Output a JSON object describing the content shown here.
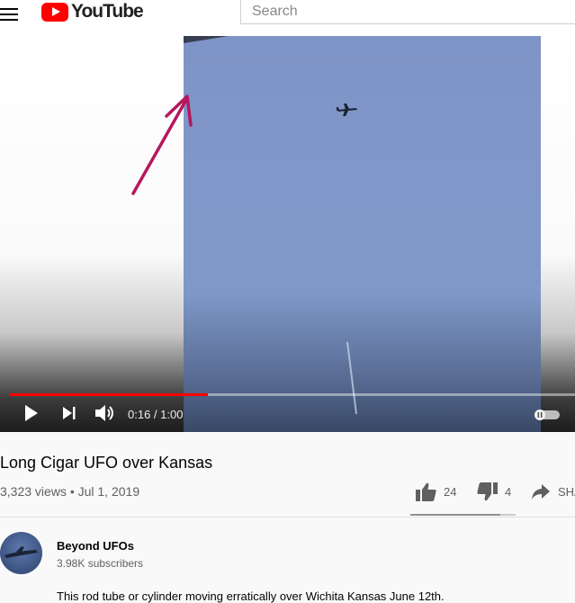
{
  "header": {
    "logo_text": "YouTube",
    "search_placeholder": "Search"
  },
  "player": {
    "time_display": "0:16 / 1:00",
    "progress_fraction": 0.35,
    "colors": {
      "progress": "#ff0000",
      "sky": "#8197c9",
      "annotation": "#b5175e"
    }
  },
  "video": {
    "title": "Long Cigar UFO over Kansas",
    "meta": "3,323 views • Jul 1, 2019",
    "like_count": "24",
    "dislike_count": "4",
    "share_label": "SHARE",
    "like_ratio": 0.857
  },
  "channel": {
    "name": "Beyond UFOs",
    "subscribers": "3.98K subscribers"
  },
  "description": {
    "text": "This rod tube or cylinder moving erratically over Wichita Kansas June 12th."
  },
  "icons": [
    "menu-icon",
    "youtube-logo-icon",
    "plane-icon",
    "arrow-annotation-icon",
    "play-icon",
    "next-icon",
    "volume-icon",
    "autoplay-toggle-icon",
    "thumbs-up-icon",
    "thumbs-down-icon",
    "share-icon"
  ]
}
